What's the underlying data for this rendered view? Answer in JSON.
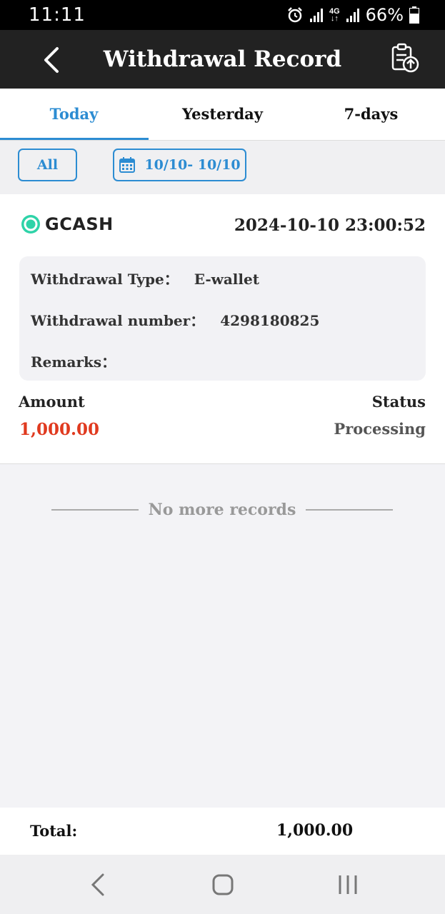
{
  "status_bar": {
    "time": "11:11",
    "network": "4G",
    "battery": "66%"
  },
  "header": {
    "title": "Withdrawal Record"
  },
  "tabs": [
    {
      "label": "Today",
      "active": true
    },
    {
      "label": "Yesterday",
      "active": false
    },
    {
      "label": "7-days",
      "active": false
    }
  ],
  "filters": {
    "type_label": "All",
    "date_range": "10/10- 10/10"
  },
  "record": {
    "channel": "GCASH",
    "datetime": "2024-10-10 23:00:52",
    "type_label": "Withdrawal Type：",
    "type_value": "E-wallet",
    "number_label": "Withdrawal number：",
    "number_value": "4298180825",
    "remarks_label": "Remarks：",
    "remarks_value": "",
    "amount_label": "Amount",
    "amount_value": "1,000.00",
    "status_label": "Status",
    "status_value": "Processing"
  },
  "list_end": "No more records",
  "footer": {
    "total_label": "Total:",
    "total_value": "1,000.00"
  },
  "colors": {
    "accent": "#2c8cd2",
    "amount": "#e03a1f",
    "header_bg": "#222222",
    "gcash_green": "#2ed3a8"
  }
}
